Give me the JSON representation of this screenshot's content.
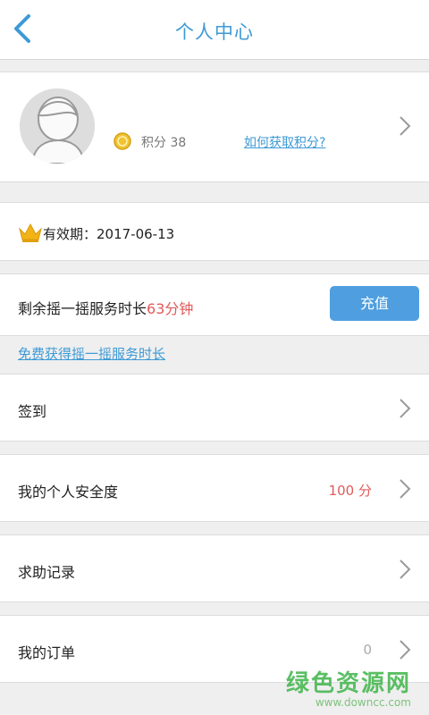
{
  "header": {
    "title": "个人中心"
  },
  "profile": {
    "points_text": "积分 38",
    "points_link": "如何获取积分?"
  },
  "validity": {
    "text": "有效期：2017-06-13"
  },
  "service": {
    "prefix": "剩余摇一摇服务时长",
    "remaining": "63分钟",
    "recharge_label": "充值",
    "free_link": "免费获得摇一摇服务时长"
  },
  "menu": {
    "checkin": {
      "label": "签到"
    },
    "security": {
      "label": "我的个人安全度",
      "value": "100 分"
    },
    "help_records": {
      "label": "求助记录"
    },
    "orders": {
      "label": "我的订单",
      "value": "0"
    }
  },
  "watermark": {
    "cn": "绿色资源网",
    "en": "www.downcc.com"
  },
  "colors": {
    "accent": "#3d9ad6",
    "button": "#4f9fe0",
    "highlight": "#e05a5a"
  }
}
